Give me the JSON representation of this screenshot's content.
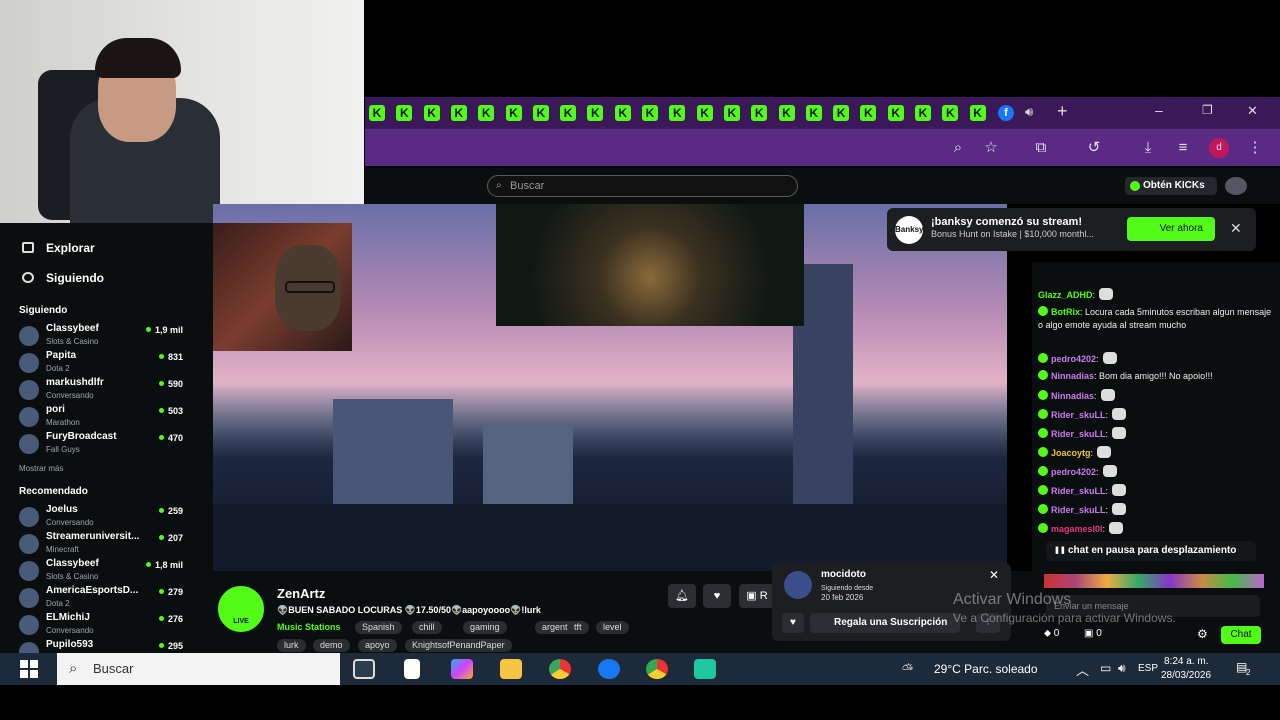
{
  "browser": {
    "tab_count": 23,
    "window_controls": {
      "minimize": "–",
      "maximize": "❐",
      "close": "✕"
    }
  },
  "header": {
    "search_placeholder": "Buscar",
    "obtain_label": "Obtén KICKs"
  },
  "notification": {
    "logo": "Banksy",
    "title": "¡banksy comenzó su stream!",
    "subtitle": "Bonus Hunt on Istake | $10,000 monthl...",
    "button": "Ver ahora",
    "close": "✕"
  },
  "sidebar": {
    "nav": [
      {
        "label": "Explorar"
      },
      {
        "label": "Siguiendo"
      }
    ],
    "following_title": "Siguiendo",
    "following": [
      {
        "name": "Classybeef",
        "game": "Slots & Casino",
        "viewers": "1,9 mil"
      },
      {
        "name": "Papita",
        "game": "Dota 2",
        "viewers": "831"
      },
      {
        "name": "markushdlfr",
        "game": "Conversando",
        "viewers": "590"
      },
      {
        "name": "pori",
        "game": "Marathon",
        "viewers": "503"
      },
      {
        "name": "FuryBroadcast",
        "game": "Fall Guys",
        "viewers": "470"
      }
    ],
    "show_more": "Mostrar más",
    "recommended_title": "Recomendado",
    "recommended": [
      {
        "name": "Joelus",
        "game": "Conversando",
        "viewers": "259"
      },
      {
        "name": "Streameruniversit...",
        "game": "Minecraft",
        "viewers": "207"
      },
      {
        "name": "Classybeef",
        "game": "Slots & Casino",
        "viewers": "1,8 mil"
      },
      {
        "name": "AmericaEsportsD...",
        "game": "Dota 2",
        "viewers": "279"
      },
      {
        "name": "ELMichiJ",
        "game": "Conversando",
        "viewers": "276"
      },
      {
        "name": "Pupilo593",
        "game": "",
        "viewers": "295"
      }
    ]
  },
  "stream": {
    "channel": "ZenArtz",
    "live": "LIVE",
    "title": "👽BUEN SABADO LOCURAS 👽17.50/50👽aapoyoooo👽!lurk",
    "category": "Music Stations",
    "tags_row1": [
      "Spanish",
      "chill",
      "gaming",
      "argentina",
      "tft",
      "level"
    ],
    "tags_row2": [
      "lurk",
      "demo",
      "apoyo",
      "KnightsofPenandPaper"
    ]
  },
  "subscription": {
    "user": "mocidoto",
    "following_since_label": "Siguiendo desde",
    "date": "20 feb 2026",
    "gift_label": "Regala una Suscripción",
    "close": "✕"
  },
  "chat": {
    "messages": [
      {
        "user": "Glazz_ADHD",
        "text": ":"
      },
      {
        "user": "BotRix",
        "text": ": Locura cada 5minutos escriban algun mensaje o algo emote ayuda al stream mucho"
      },
      {
        "user": "pedro4202",
        "text": ":"
      },
      {
        "user": "Ninnadias",
        "text": ": Bom dia amigo!!! No apoio!!!"
      },
      {
        "user": "Ninnadias",
        "text": ":"
      },
      {
        "user": "Rider_skuLL",
        "text": ":"
      },
      {
        "user": "Rider_skuLL",
        "text": ":"
      },
      {
        "user": "Joacoytg",
        "text": ":"
      },
      {
        "user": "pedro4202",
        "text": ":"
      },
      {
        "user": "Rider_skuLL",
        "text": ":"
      },
      {
        "user": "Rider_skuLL",
        "text": ":"
      },
      {
        "user": "magamesl0l",
        "text": ":"
      }
    ],
    "pause_label": "chat en pausa para desplazamiento",
    "input_placeholder": "Enviar un mensaje",
    "kicks": "0",
    "subs": "0",
    "send_label": "Chat"
  },
  "watermark": {
    "line1": "Activar Windows",
    "line2": "Ve a Configuración para activar Windows."
  },
  "taskbar": {
    "search_placeholder": "Buscar",
    "weather": "29°C  Parc. soleado",
    "lang": "ESP",
    "time": "8:24 a. m.",
    "date": "28/03/2026",
    "notifications": "2"
  },
  "colors": {
    "kick_green": "#53fc18",
    "tab_purple": "#3b1858",
    "toolbar_purple": "#5a2a85"
  }
}
